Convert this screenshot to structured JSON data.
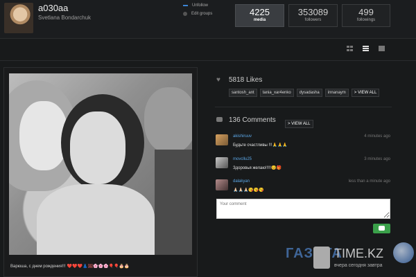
{
  "profile": {
    "username": "a030aa",
    "full_name": "Svetlana Bondarchuk",
    "actions": {
      "unfollow": "Unfollow",
      "edit_groups": "Edit groups"
    },
    "stats": {
      "media": {
        "value": "4225",
        "label": "media"
      },
      "followers": {
        "value": "353089",
        "label": "followers"
      },
      "followings": {
        "value": "499",
        "label": "followings"
      }
    }
  },
  "view_modes": [
    "grid-icon",
    "list-icon",
    "single-icon"
  ],
  "post": {
    "caption": "Варюша, с днем рождения!!!",
    "caption_emoji": "❤️❤️❤️👗🖼🌸🌸🌸🎈🎈🎂🎂"
  },
  "likes": {
    "count_text": "5818 Likes",
    "likers": [
      "santosh_ant",
      "tania_xar4enko",
      "dysadasha",
      "innanaym"
    ],
    "view_all": "> VIEW ALL"
  },
  "comments": {
    "count_text": "136 Comments",
    "view_all": "> VIEW ALL",
    "items": [
      {
        "user": "akishiruuv",
        "time": "4 minutes ago",
        "text": "Будьте счастливы !!!🙏🙏🙏"
      },
      {
        "user": "movcllu25",
        "time": "3 minutes ago",
        "text": "Здоровья желаю!!!!!😊🎁"
      },
      {
        "user": "dalakyan",
        "time": "less than a minute ago",
        "text": "🙏🏻🙏🏻🙏🏻😘😘😘"
      }
    ],
    "input_placeholder": "Your comment"
  },
  "watermark": {
    "main": "ГАЗЕТА",
    "brand": "TIME.KZ",
    "tagline": "вчера сегодня завтра"
  },
  "colors": {
    "accent_blue": "#5ca8e8",
    "send_green": "#3aa04a",
    "background": "#181a1b"
  }
}
